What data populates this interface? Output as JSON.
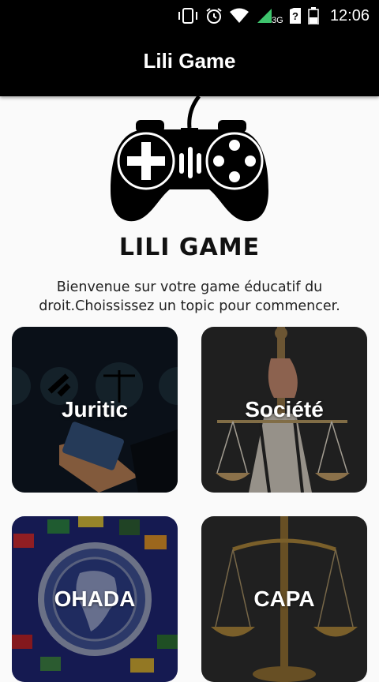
{
  "status_bar": {
    "time": "12:06",
    "network": "3G"
  },
  "app_bar": {
    "title": "Lili Game"
  },
  "logo": {
    "text": "LILI GAME"
  },
  "welcome_text": "Bienvenue sur votre game éducatif du droit.Choississez un topic pour commencer.",
  "topics": [
    {
      "label": "Juritic"
    },
    {
      "label": "Société"
    },
    {
      "label": "OHADA"
    },
    {
      "label": "CAPA"
    }
  ]
}
